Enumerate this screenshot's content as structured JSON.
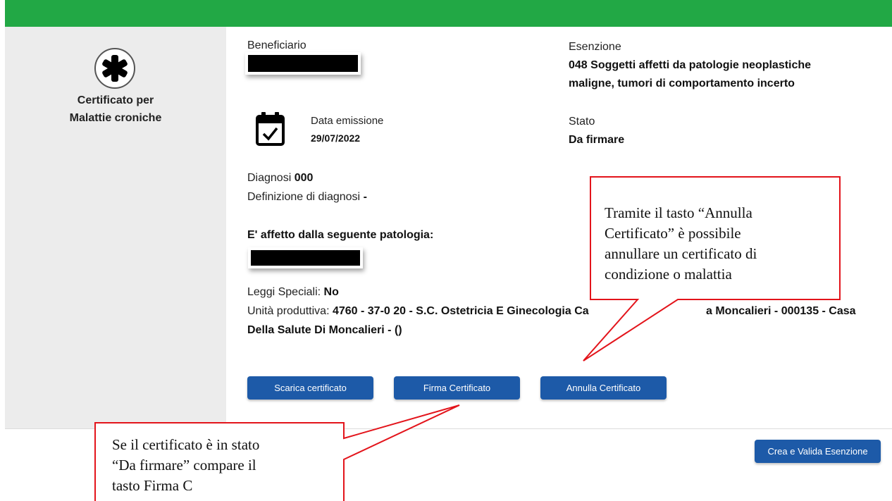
{
  "sidebar": {
    "icon": "asterisk-icon",
    "title_line1": "Certificato per",
    "title_line2": "Malattie croniche"
  },
  "beneficiario": {
    "label": "Beneficiario"
  },
  "esenzione": {
    "label": "Esenzione",
    "value_line1": "048 Soggetti affetti da patologie neoplastiche",
    "value_line2": "maligne, tumori di comportamento incerto"
  },
  "data_emissione": {
    "icon": "calendar-check-icon",
    "label": "Data emissione",
    "value": "29/07/2022"
  },
  "stato": {
    "label": "Stato",
    "value": "Da firmare"
  },
  "diagnosi": {
    "label": "Diagnosi",
    "value": "000"
  },
  "definizione": {
    "label": "Definizione di diagnosi",
    "value": "-"
  },
  "patologia": {
    "label": "E' affetto dalla seguente patologia:"
  },
  "leggi_speciali": {
    "label": "Leggi Speciali:",
    "value": "No"
  },
  "unita_produttiva": {
    "label": "Unità produttiva:",
    "value_part1": "4760 - 37-0 20 - S.C. Ostetricia E Ginecologia Ca",
    "value_part2": "a Moncalieri - 000135 - Casa",
    "value_line2": "Della Salute Di Moncalieri - ()"
  },
  "buttons": {
    "scarica": "Scarica certificato",
    "firma": "Firma Certificato",
    "annulla": "Annulla Certificato",
    "crea_valida": "Crea e Valida Esenzione"
  },
  "callouts": {
    "annulla": [
      "Tramite il tasto “Annulla",
      "Certificato” è possibile",
      "annullare un certificato di",
      "condizione o malattia"
    ],
    "firma": [
      "Se il certificato è in stato",
      "“Da firmare” compare il",
      "tasto Firma C"
    ]
  },
  "colors": {
    "header": "#22a845",
    "button": "#1d5aa8",
    "callout_border": "#e3141b",
    "sidebar_bg": "#ececec"
  }
}
